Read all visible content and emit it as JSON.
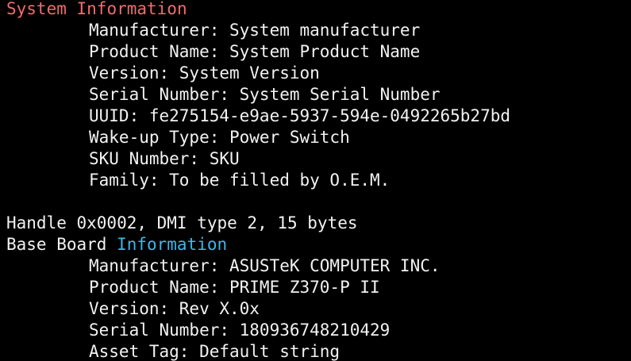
{
  "colors": {
    "background": "#000000",
    "text": "#f2f2f2",
    "highlight_red": "#f06c6c",
    "highlight_cyan": "#3fb5e8"
  },
  "system_section": {
    "heading_word1": "System",
    "heading_word2": "Information",
    "fields": [
      "Manufacturer: System manufacturer",
      "Product Name: System Product Name",
      "Version: System Version",
      "Serial Number: System Serial Number",
      "UUID: fe275154-e9ae-5937-594e-0492265b27bd",
      "Wake-up Type: Power Switch",
      "SKU Number: SKU",
      "Family: To be filled by O.E.M."
    ]
  },
  "handle_line": "Handle 0x0002, DMI type 2, 15 bytes",
  "baseboard_section": {
    "heading_prefix": "Base Board ",
    "heading_highlight": "Information",
    "fields": [
      "Manufacturer: ASUSTeK COMPUTER INC.",
      "Product Name: PRIME Z370-P II",
      "Version: Rev X.0x",
      "Serial Number: 180936748210429",
      "Asset Tag: Default string"
    ]
  }
}
